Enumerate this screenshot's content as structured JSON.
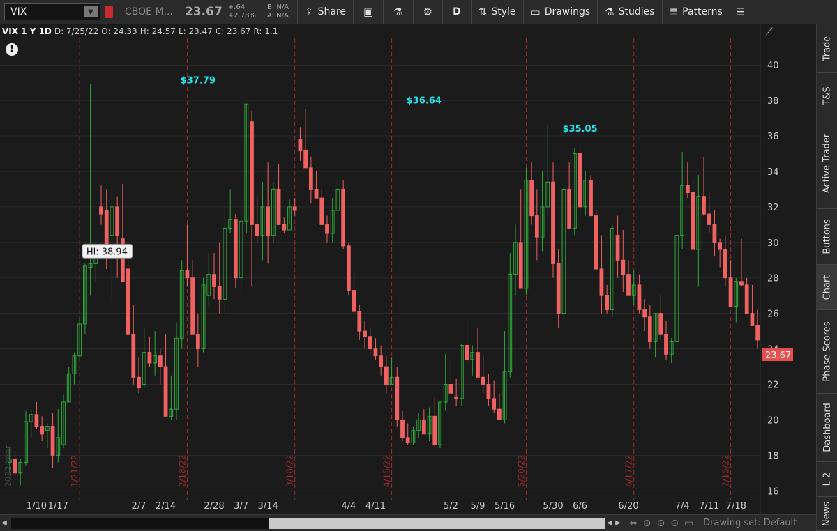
{
  "toolbar": {
    "symbol": "VIX",
    "company": "CBOE M...",
    "last": "23.67",
    "change": "+.64",
    "change_pct": "+2.78%",
    "bid": "B: N/A",
    "ask": "A: N/A",
    "share": "Share",
    "aggregation": "D",
    "style": "Style",
    "drawings": "Drawings",
    "studies": "Studies",
    "patterns": "Patterns"
  },
  "header": {
    "symbol": "VIX 1 Y 1D",
    "date": "D: 7/25/22",
    "open": "O: 24.33",
    "high": "H: 24.57",
    "low": "L: 23.47",
    "close": "C: 23.67",
    "range": "R: 1.1"
  },
  "sidebar": [
    "Trade",
    "T&S",
    "Active Trader",
    "Buttons",
    "Chart",
    "Phase Scores",
    "Dashboard",
    "L 2",
    "News"
  ],
  "bottom": {
    "drawing_set": "Drawing set: Default"
  },
  "colors": {
    "up": "#2fa83a",
    "down": "#f06262",
    "marker": "#9e2b2b",
    "bubble_text": "#20e8f2",
    "price_tag": "#e94c4c"
  },
  "chart_data": {
    "type": "candlestick",
    "ylim": [
      15.5,
      41.5
    ],
    "yticks": [
      16,
      18,
      20,
      22,
      24,
      26,
      28,
      30,
      32,
      34,
      36,
      38,
      40
    ],
    "xticks": [
      {
        "label": "1/10",
        "i": 5
      },
      {
        "label": "1/17",
        "i": 9
      },
      {
        "label": "2/7",
        "i": 24
      },
      {
        "label": "2/14",
        "i": 29
      },
      {
        "label": "2/28",
        "i": 38
      },
      {
        "label": "3/7",
        "i": 43
      },
      {
        "label": "3/14",
        "i": 48
      },
      {
        "label": "4/4",
        "i": 63
      },
      {
        "label": "4/11",
        "i": 68
      },
      {
        "label": "5/2",
        "i": 82
      },
      {
        "label": "5/9",
        "i": 87
      },
      {
        "label": "5/16",
        "i": 92
      },
      {
        "label": "5/30",
        "i": 101
      },
      {
        "label": "6/6",
        "i": 106
      },
      {
        "label": "6/20",
        "i": 115
      },
      {
        "label": "7/4",
        "i": 125
      },
      {
        "label": "7/11",
        "i": 130
      },
      {
        "label": "7/18",
        "i": 135
      }
    ],
    "expiration_markers": [
      {
        "label": "1/21/22",
        "i": 13
      },
      {
        "label": "2/18/22",
        "i": 33
      },
      {
        "label": "3/18/22",
        "i": 53
      },
      {
        "label": "4/15/22",
        "i": 71
      },
      {
        "label": "5/20/22",
        "i": 96
      },
      {
        "label": "6/17/22",
        "i": 116
      },
      {
        "label": "7/15/22",
        "i": 134
      }
    ],
    "year_label": "2022 Year",
    "hi_bubble": {
      "label": "Hi: 38.94",
      "i": 14
    },
    "peak_labels": [
      {
        "label": "$37.79",
        "i": 35,
        "value": 37.79
      },
      {
        "label": "$36.64",
        "i": 77,
        "value": 36.64
      },
      {
        "label": "$35.05",
        "i": 106,
        "value": 35.05
      }
    ],
    "last_price": {
      "label": "23.67",
      "value": 23.67
    },
    "candles": [
      [
        17.6,
        18.4,
        17.0,
        17.8
      ],
      [
        17.8,
        18.2,
        16.6,
        17.0
      ],
      [
        17.0,
        17.8,
        16.3,
        17.6
      ],
      [
        17.6,
        20.5,
        17.4,
        19.9
      ],
      [
        19.9,
        20.6,
        19.0,
        20.3
      ],
      [
        20.3,
        21.0,
        19.5,
        19.6
      ],
      [
        19.6,
        20.2,
        18.8,
        19.2
      ],
      [
        19.4,
        19.8,
        18.4,
        19.6
      ],
      [
        19.6,
        20.4,
        17.3,
        18.0
      ],
      [
        18.0,
        20.6,
        17.6,
        19.0
      ],
      [
        18.6,
        21.4,
        18.4,
        21.0
      ],
      [
        21.0,
        23.0,
        21.0,
        22.6
      ],
      [
        22.6,
        23.8,
        22.0,
        23.6
      ],
      [
        23.6,
        25.8,
        23.4,
        25.4
      ],
      [
        25.4,
        28.8,
        24.8,
        28.7
      ],
      [
        28.6,
        38.9,
        27.0,
        28.8
      ],
      [
        28.8,
        30.0,
        27.8,
        29.8
      ],
      [
        32.0,
        33.2,
        31.0,
        31.6
      ],
      [
        31.8,
        33.0,
        28.5,
        29.6
      ],
      [
        30.4,
        33.2,
        26.8,
        32.0
      ],
      [
        32.0,
        32.6,
        28.0,
        30.4
      ],
      [
        30.2,
        33.3,
        29.6,
        27.8
      ],
      [
        28.5,
        29.0,
        26.5,
        24.8
      ],
      [
        24.8,
        26.5,
        22.0,
        22.4
      ],
      [
        22.4,
        23.5,
        21.5,
        21.8
      ],
      [
        22.0,
        25.2,
        21.8,
        23.8
      ],
      [
        23.8,
        24.7,
        23.0,
        23.2
      ],
      [
        23.2,
        25.0,
        22.5,
        23.6
      ],
      [
        23.6,
        24.0,
        22.0,
        23.0
      ],
      [
        23.0,
        24.8,
        20.6,
        20.2
      ],
      [
        20.2,
        22.5,
        20.0,
        20.6
      ],
      [
        20.6,
        25.5,
        20.0,
        24.6
      ],
      [
        24.6,
        29.0,
        24.0,
        28.4
      ],
      [
        28.4,
        31.0,
        27.5,
        28.0
      ],
      [
        28.0,
        29.0,
        25.2,
        24.8
      ],
      [
        24.8,
        26.0,
        23.0,
        24.0
      ],
      [
        24.0,
        28.0,
        23.8,
        27.6
      ],
      [
        27.0,
        29.4,
        26.5,
        28.2
      ],
      [
        28.2,
        29.4,
        26.8,
        27.5
      ],
      [
        27.5,
        30.0,
        26.0,
        26.8
      ],
      [
        26.8,
        32.0,
        26.0,
        30.8
      ],
      [
        30.8,
        33.0,
        30.5,
        31.3
      ],
      [
        31.3,
        31.6,
        27.4,
        28.0
      ],
      [
        28.0,
        32.5,
        27.0,
        31.2
      ],
      [
        31.2,
        37.8,
        30.5,
        37.8
      ],
      [
        36.8,
        37.4,
        27.5,
        31.0
      ],
      [
        31.0,
        32.6,
        30.0,
        30.4
      ],
      [
        30.4,
        33.4,
        29.0,
        32.0
      ],
      [
        32.0,
        34.5,
        28.8,
        30.4
      ],
      [
        30.4,
        33.4,
        30.0,
        33.0
      ],
      [
        33.0,
        34.4,
        32.0,
        31.0
      ],
      [
        31.0,
        31.4,
        30.5,
        30.7
      ],
      [
        30.7,
        32.4,
        31.0,
        32.0
      ],
      [
        32.0,
        32.5,
        31.5,
        31.8
      ],
      [
        35.8,
        36.5,
        34.6,
        35.2
      ],
      [
        35.2,
        37.5,
        34.5,
        34.2
      ],
      [
        34.2,
        34.8,
        32.2,
        33.0
      ],
      [
        33.0,
        34.0,
        32.5,
        32.5
      ],
      [
        32.5,
        33.0,
        31.0,
        31.0
      ],
      [
        31.0,
        31.5,
        30.0,
        30.5
      ],
      [
        30.5,
        32.5,
        30.0,
        31.8
      ],
      [
        31.8,
        33.8,
        31.0,
        33.0
      ],
      [
        33.0,
        33.5,
        29.6,
        29.8
      ],
      [
        29.8,
        30.0,
        27.0,
        27.3
      ],
      [
        27.3,
        28.4,
        26.0,
        26.1
      ],
      [
        26.1,
        26.5,
        24.5,
        25.0
      ],
      [
        25.0,
        25.6,
        24.0,
        24.7
      ],
      [
        24.7,
        25.2,
        23.7,
        24.0
      ],
      [
        24.0,
        24.6,
        23.4,
        23.6
      ],
      [
        23.6,
        24.2,
        22.5,
        23.0
      ],
      [
        23.0,
        23.6,
        21.5,
        22.0
      ],
      [
        22.0,
        23.5,
        22.0,
        22.4
      ],
      [
        22.4,
        23.0,
        19.6,
        20.0
      ],
      [
        20.0,
        20.5,
        18.8,
        19.0
      ],
      [
        19.0,
        19.8,
        18.6,
        18.7
      ],
      [
        18.7,
        19.6,
        18.6,
        19.4
      ],
      [
        19.4,
        20.4,
        19.0,
        20.0
      ],
      [
        20.0,
        20.6,
        19.2,
        19.2
      ],
      [
        19.2,
        20.7,
        18.8,
        20.2
      ],
      [
        20.2,
        21.3,
        18.5,
        18.6
      ],
      [
        18.6,
        21.0,
        18.4,
        21.0
      ],
      [
        21.0,
        23.7,
        20.5,
        22.0
      ],
      [
        22.0,
        23.4,
        21.5,
        21.5
      ],
      [
        21.3,
        22.3,
        20.8,
        21.2
      ],
      [
        21.2,
        24.3,
        20.8,
        24.2
      ],
      [
        24.2,
        25.6,
        23.2,
        23.4
      ],
      [
        23.4,
        24.2,
        22.5,
        23.8
      ],
      [
        23.8,
        25.2,
        23.0,
        22.4
      ],
      [
        22.4,
        23.6,
        21.5,
        22.0
      ],
      [
        22.0,
        22.6,
        20.8,
        21.2
      ],
      [
        21.2,
        22.2,
        20.4,
        20.6
      ],
      [
        20.6,
        21.5,
        20.0,
        20.0
      ],
      [
        20.0,
        25.0,
        19.8,
        22.7
      ],
      [
        22.7,
        29.4,
        22.4,
        28.2
      ],
      [
        28.2,
        31.0,
        27.0,
        30.0
      ],
      [
        30.0,
        33.0,
        28.0,
        27.4
      ],
      [
        27.4,
        34.2,
        27.0,
        33.5
      ],
      [
        33.5,
        34.5,
        31.0,
        31.5
      ],
      [
        31.5,
        33.0,
        29.0,
        30.3
      ],
      [
        30.3,
        34.0,
        29.5,
        32.0
      ],
      [
        32.0,
        36.6,
        31.5,
        33.4
      ],
      [
        33.4,
        34.5,
        28.0,
        28.8
      ],
      [
        28.8,
        29.6,
        25.2,
        26.0
      ],
      [
        26.0,
        33.2,
        25.5,
        33.0
      ],
      [
        33.0,
        34.5,
        31.0,
        30.8
      ],
      [
        30.8,
        35.3,
        30.4,
        35.0
      ],
      [
        35.0,
        35.5,
        31.5,
        32.0
      ],
      [
        32.0,
        34.0,
        31.5,
        33.5
      ],
      [
        33.5,
        33.8,
        31.5,
        31.5
      ],
      [
        31.5,
        31.8,
        28.5,
        28.5
      ],
      [
        28.5,
        30.4,
        26.0,
        27.0
      ],
      [
        27.0,
        27.6,
        26.0,
        26.2
      ],
      [
        26.2,
        31.0,
        25.8,
        30.8
      ],
      [
        30.4,
        31.5,
        28.0,
        29.0
      ],
      [
        29.0,
        30.7,
        27.2,
        28.2
      ],
      [
        28.2,
        29.0,
        27.0,
        27.0
      ],
      [
        27.0,
        28.4,
        26.5,
        27.6
      ],
      [
        27.6,
        28.2,
        26.0,
        26.2
      ],
      [
        26.2,
        26.8,
        25.0,
        25.8
      ],
      [
        25.8,
        26.5,
        24.0,
        24.4
      ],
      [
        24.4,
        26.0,
        23.5,
        26.0
      ],
      [
        26.0,
        27.0,
        24.5,
        24.8
      ],
      [
        24.8,
        25.6,
        23.4,
        23.7
      ],
      [
        23.7,
        24.6,
        23.2,
        24.4
      ],
      [
        24.4,
        30.4,
        24.0,
        30.4
      ],
      [
        30.4,
        35.1,
        29.6,
        33.2
      ],
      [
        33.2,
        34.5,
        32.5,
        32.8
      ],
      [
        32.8,
        33.5,
        30.2,
        29.6
      ],
      [
        29.6,
        33.8,
        27.5,
        32.6
      ],
      [
        32.6,
        34.8,
        31.5,
        31.6
      ],
      [
        31.6,
        32.8,
        30.5,
        31.0
      ],
      [
        31.0,
        31.8,
        29.2,
        30.0
      ],
      [
        30.0,
        30.2,
        28.6,
        29.6
      ],
      [
        29.6,
        30.4,
        27.5,
        28.0
      ],
      [
        28.0,
        29.0,
        26.5,
        26.4
      ],
      [
        26.4,
        28.0,
        25.5,
        27.8
      ],
      [
        27.8,
        30.2,
        27.5,
        27.6
      ],
      [
        27.6,
        28.0,
        26.5,
        26.0
      ],
      [
        26.0,
        27.6,
        25.5,
        25.3
      ],
      [
        25.3,
        26.2,
        24.0,
        24.5
      ]
    ]
  }
}
